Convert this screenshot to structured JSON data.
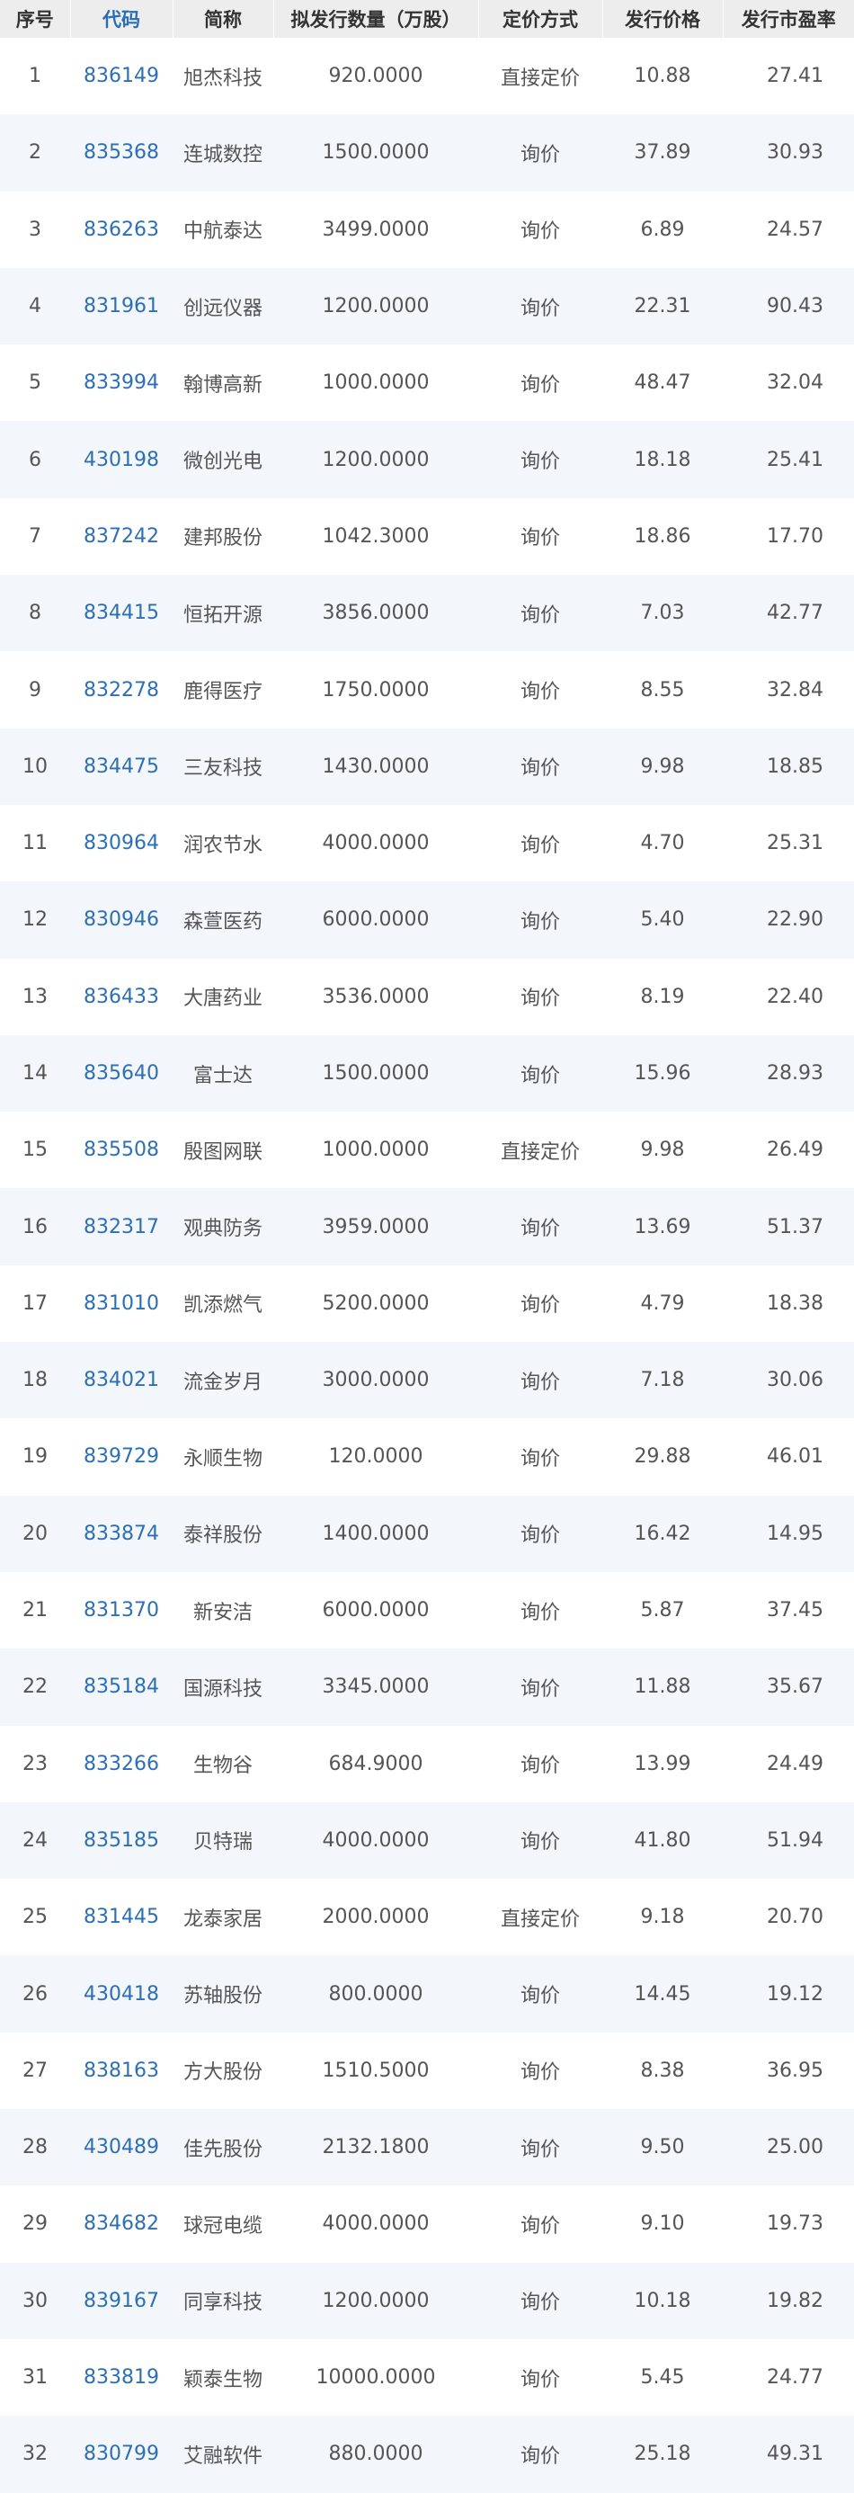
{
  "headers": [
    "序号",
    "代码",
    "简称",
    "拟发行数量（万股）",
    "定价方式",
    "发行价格",
    "发行市盈率"
  ],
  "rows": [
    {
      "no": "1",
      "code": "836149",
      "name": "旭杰科技",
      "quantity": "920.0000",
      "method": "直接定价",
      "price": "10.88",
      "pe": "27.41"
    },
    {
      "no": "2",
      "code": "835368",
      "name": "连城数控",
      "quantity": "1500.0000",
      "method": "询价",
      "price": "37.89",
      "pe": "30.93"
    },
    {
      "no": "3",
      "code": "836263",
      "name": "中航泰达",
      "quantity": "3499.0000",
      "method": "询价",
      "price": "6.89",
      "pe": "24.57"
    },
    {
      "no": "4",
      "code": "831961",
      "name": "创远仪器",
      "quantity": "1200.0000",
      "method": "询价",
      "price": "22.31",
      "pe": "90.43"
    },
    {
      "no": "5",
      "code": "833994",
      "name": "翰博高新",
      "quantity": "1000.0000",
      "method": "询价",
      "price": "48.47",
      "pe": "32.04"
    },
    {
      "no": "6",
      "code": "430198",
      "name": "微创光电",
      "quantity": "1200.0000",
      "method": "询价",
      "price": "18.18",
      "pe": "25.41"
    },
    {
      "no": "7",
      "code": "837242",
      "name": "建邦股份",
      "quantity": "1042.3000",
      "method": "询价",
      "price": "18.86",
      "pe": "17.70"
    },
    {
      "no": "8",
      "code": "834415",
      "name": "恒拓开源",
      "quantity": "3856.0000",
      "method": "询价",
      "price": "7.03",
      "pe": "42.77"
    },
    {
      "no": "9",
      "code": "832278",
      "name": "鹿得医疗",
      "quantity": "1750.0000",
      "method": "询价",
      "price": "8.55",
      "pe": "32.84"
    },
    {
      "no": "10",
      "code": "834475",
      "name": "三友科技",
      "quantity": "1430.0000",
      "method": "询价",
      "price": "9.98",
      "pe": "18.85"
    },
    {
      "no": "11",
      "code": "830964",
      "name": "润农节水",
      "quantity": "4000.0000",
      "method": "询价",
      "price": "4.70",
      "pe": "25.31"
    },
    {
      "no": "12",
      "code": "830946",
      "name": "森萱医药",
      "quantity": "6000.0000",
      "method": "询价",
      "price": "5.40",
      "pe": "22.90"
    },
    {
      "no": "13",
      "code": "836433",
      "name": "大唐药业",
      "quantity": "3536.0000",
      "method": "询价",
      "price": "8.19",
      "pe": "22.40"
    },
    {
      "no": "14",
      "code": "835640",
      "name": "富士达",
      "quantity": "1500.0000",
      "method": "询价",
      "price": "15.96",
      "pe": "28.93"
    },
    {
      "no": "15",
      "code": "835508",
      "name": "殷图网联",
      "quantity": "1000.0000",
      "method": "直接定价",
      "price": "9.98",
      "pe": "26.49"
    },
    {
      "no": "16",
      "code": "832317",
      "name": "观典防务",
      "quantity": "3959.0000",
      "method": "询价",
      "price": "13.69",
      "pe": "51.37"
    },
    {
      "no": "17",
      "code": "831010",
      "name": "凯添燃气",
      "quantity": "5200.0000",
      "method": "询价",
      "price": "4.79",
      "pe": "18.38"
    },
    {
      "no": "18",
      "code": "834021",
      "name": "流金岁月",
      "quantity": "3000.0000",
      "method": "询价",
      "price": "7.18",
      "pe": "30.06"
    },
    {
      "no": "19",
      "code": "839729",
      "name": "永顺生物",
      "quantity": "120.0000",
      "method": "询价",
      "price": "29.88",
      "pe": "46.01"
    },
    {
      "no": "20",
      "code": "833874",
      "name": "泰祥股份",
      "quantity": "1400.0000",
      "method": "询价",
      "price": "16.42",
      "pe": "14.95"
    },
    {
      "no": "21",
      "code": "831370",
      "name": "新安洁",
      "quantity": "6000.0000",
      "method": "询价",
      "price": "5.87",
      "pe": "37.45"
    },
    {
      "no": "22",
      "code": "835184",
      "name": "国源科技",
      "quantity": "3345.0000",
      "method": "询价",
      "price": "11.88",
      "pe": "35.67"
    },
    {
      "no": "23",
      "code": "833266",
      "name": "生物谷",
      "quantity": "684.9000",
      "method": "询价",
      "price": "13.99",
      "pe": "24.49"
    },
    {
      "no": "24",
      "code": "835185",
      "name": "贝特瑞",
      "quantity": "4000.0000",
      "method": "询价",
      "price": "41.80",
      "pe": "51.94"
    },
    {
      "no": "25",
      "code": "831445",
      "name": "龙泰家居",
      "quantity": "2000.0000",
      "method": "直接定价",
      "price": "9.18",
      "pe": "20.70"
    },
    {
      "no": "26",
      "code": "430418",
      "name": "苏轴股份",
      "quantity": "800.0000",
      "method": "询价",
      "price": "14.45",
      "pe": "19.12"
    },
    {
      "no": "27",
      "code": "838163",
      "name": "方大股份",
      "quantity": "1510.5000",
      "method": "询价",
      "price": "8.38",
      "pe": "36.95"
    },
    {
      "no": "28",
      "code": "430489",
      "name": "佳先股份",
      "quantity": "2132.1800",
      "method": "询价",
      "price": "9.50",
      "pe": "25.00"
    },
    {
      "no": "29",
      "code": "834682",
      "name": "球冠电缆",
      "quantity": "4000.0000",
      "method": "询价",
      "price": "9.10",
      "pe": "19.73"
    },
    {
      "no": "30",
      "code": "839167",
      "name": "同享科技",
      "quantity": "1200.0000",
      "method": "询价",
      "price": "10.18",
      "pe": "19.82"
    },
    {
      "no": "31",
      "code": "833819",
      "name": "颖泰生物",
      "quantity": "10000.0000",
      "method": "询价",
      "price": "5.45",
      "pe": "24.77"
    },
    {
      "no": "32",
      "code": "830799",
      "name": "艾融软件",
      "quantity": "880.0000",
      "method": "询价",
      "price": "25.18",
      "pe": "49.31"
    }
  ],
  "colors": {
    "header_bg": "#ededed",
    "code_link": "#2c6fb7",
    "row_alt_bg": "#f3f7fb",
    "text": "#555555"
  }
}
